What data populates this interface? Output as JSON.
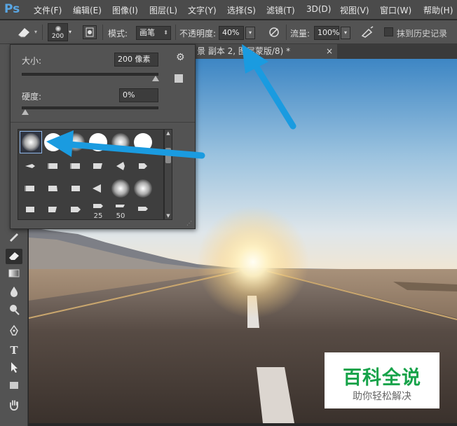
{
  "app": {
    "logo": "Ps"
  },
  "menu": [
    "文件(F)",
    "编辑(E)",
    "图像(I)",
    "图层(L)",
    "文字(Y)",
    "选择(S)",
    "滤镜(T)",
    "3D(D)",
    "视图(V)",
    "窗口(W)",
    "帮助(H)"
  ],
  "options": {
    "brush_size": "200",
    "mode_label": "模式:",
    "mode_value": "画笔",
    "opacity_label": "不透明度:",
    "opacity_value": "40%",
    "flow_label": "流量:",
    "flow_value": "100%",
    "history_label": "抹到历史记录"
  },
  "document_tab": {
    "title": "景 副本 2, 图层蒙版/8) *",
    "close": "×"
  },
  "brush_panel": {
    "size_label": "大小:",
    "size_value": "200 像素",
    "size_fraction": 0.98,
    "hardness_label": "硬度:",
    "hardness_value": "0%",
    "hardness_fraction": 0.0,
    "preset_labels": [
      "25",
      "50"
    ]
  },
  "watermark": {
    "title": "百科全说",
    "subtitle": "助你轻松解决"
  },
  "colors": {
    "accent": "#1a9be0",
    "menubar": "#4b4b4b",
    "panel": "#535353"
  },
  "icons": {
    "eraser": "eraser-icon",
    "airbrush": "airbrush-icon",
    "pressure": "pressure-icon",
    "gear": "gear-icon"
  }
}
